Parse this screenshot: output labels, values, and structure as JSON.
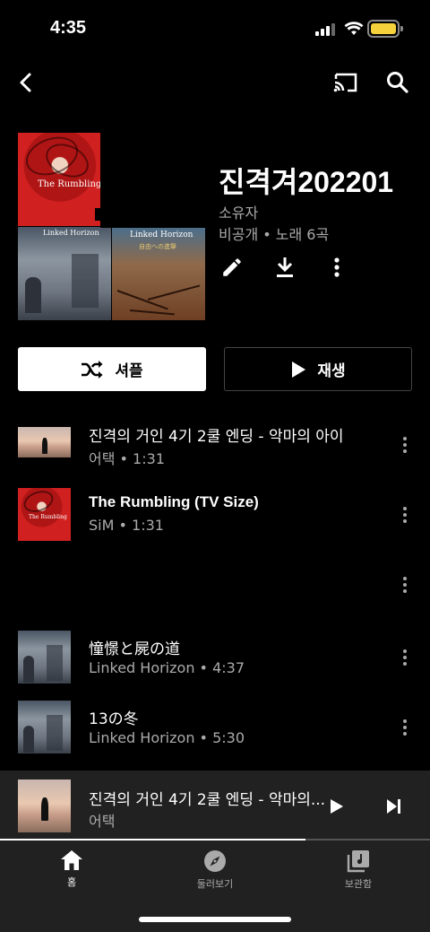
{
  "status": {
    "time": "4:35"
  },
  "topbar": {
    "back": "back-icon",
    "cast": "cast-icon",
    "search": "search-icon"
  },
  "playlist": {
    "cover_labels": {
      "tile1": "The Rumbling",
      "tile2": "Linked Horizon",
      "tile3": "Linked Horizon",
      "tile3_sub": "自由への進撃"
    },
    "title": "진격겨202201",
    "owner": "소유자",
    "meta": "비공개 • 노래 6곡"
  },
  "actions": {
    "edit": "edit-icon",
    "download": "download-icon",
    "more": "more-vert-icon"
  },
  "buttons": {
    "shuffle": "셔플",
    "play": "재생"
  },
  "tracks": [
    {
      "title": "진격의 거인 4기 2쿨 엔딩 - 악마의 아이",
      "subtitle": "어택 • 1:31",
      "art": "sunset"
    },
    {
      "title": "The Rumbling (TV Size)",
      "subtitle": "SiM • 1:31",
      "art": "rumbling"
    },
    {
      "title": "",
      "subtitle": "",
      "art": "none"
    },
    {
      "title": "憧憬と屍の道",
      "subtitle": "Linked Horizon • 4:37",
      "art": "horizon-grey"
    },
    {
      "title": "13の冬",
      "subtitle": "Linked Horizon • 5:30",
      "art": "horizon-grey"
    }
  ],
  "mini_player": {
    "title": "진격의 거인 4기 2쿨 엔딩 - 악마의...",
    "artist": "어택",
    "progress": 0.71
  },
  "nav": [
    {
      "label": "홈",
      "icon": "home-icon"
    },
    {
      "label": "둘러보기",
      "icon": "explore-icon"
    },
    {
      "label": "보관함",
      "icon": "library-icon"
    }
  ],
  "colors": {
    "background": "#000000",
    "surface": "#212121",
    "secondary_text": "#aaaaaa",
    "battery": "#f5d13b"
  }
}
